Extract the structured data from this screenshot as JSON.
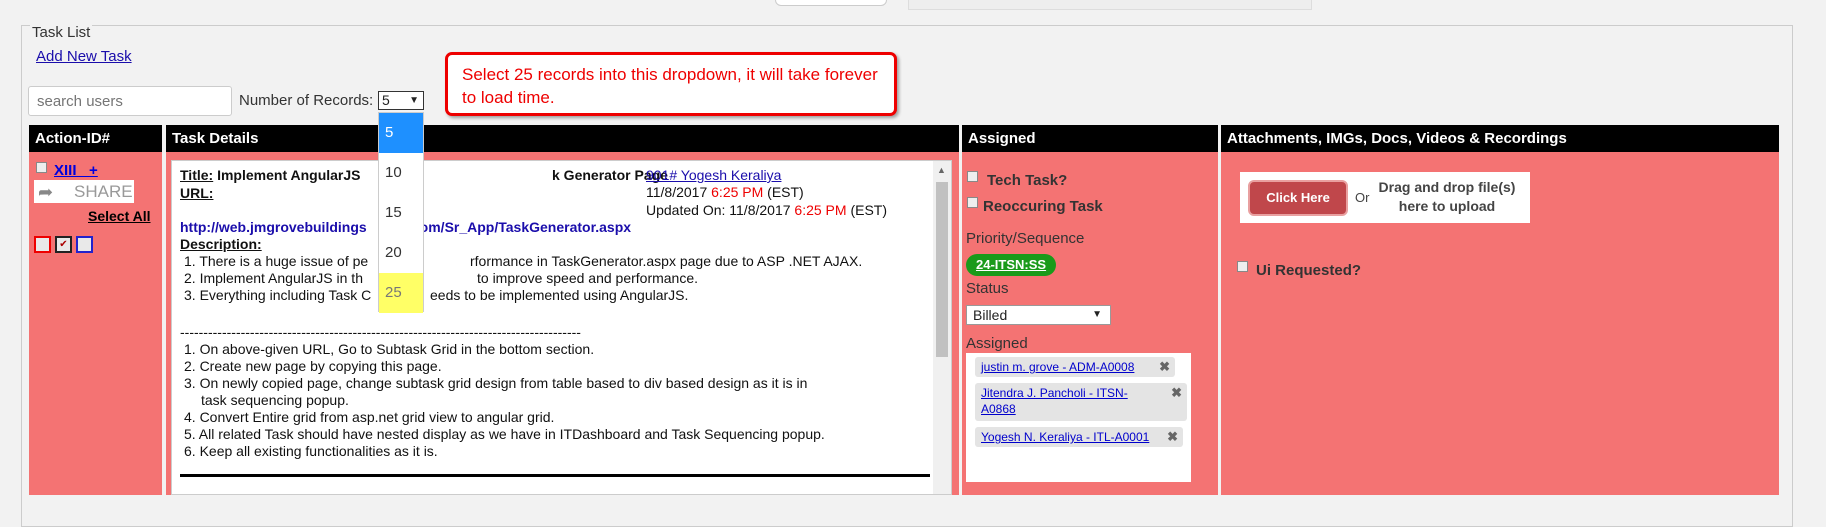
{
  "fieldset": {
    "legend": "Task List",
    "add_new_task": "Add New Task"
  },
  "search": {
    "placeholder": "search users"
  },
  "records": {
    "label": "Number of Records:",
    "selected": "5",
    "options": [
      "5",
      "10",
      "15",
      "20",
      "25"
    ]
  },
  "callout": {
    "text": "Select 25 records into this dropdown, it will take forever to load time."
  },
  "table": {
    "headers": [
      "Action-ID#",
      "Task Details",
      "Assigned",
      "Attachments, IMGs, Docs, Videos & Recordings"
    ]
  },
  "action": {
    "id_link": "XIII",
    "plus": "+",
    "share": "SHARE",
    "select_all": "Select All",
    "mini_check": "✔"
  },
  "task": {
    "title_label": "Title:",
    "title": "Implement AngularJS",
    "title_tail": "k Generator Page",
    "url_label": "URL:",
    "url_a": "http://web.jmgrovebuildings",
    "url_b": ".com/Sr_App/TaskGenerator.aspx",
    "owner_link": "901# Yogesh Keraliya",
    "created_date": "11/8/2017",
    "created_time": "6:25 PM",
    "tz": "(EST)",
    "updated_label": "Updated On: 11/8/2017",
    "updated_time": "6:25 PM",
    "description_label": "Description:",
    "desc_lines": [
      "1. There is a huge issue of pe",
      "1. There is a huge issue of performance in TaskGenerator.aspx page due to ASP .NET AJAX.",
      "2. Implement AngularJS in th",
      "to improve speed and performance.",
      "3. Everything including Task C",
      "eeds to be implemented using AngularJS."
    ],
    "separator": "--------------------------------------------------------------------------------------",
    "steps": [
      "1. On above-given URL, Go to Subtask Grid in the bottom section.",
      "2. Create new page by copying this page.",
      "3. On newly copied page, change subtask grid design from table based to div based design as it is in",
      "task sequencing popup.",
      "4. Convert Entire grid from asp.net grid view to angular grid.",
      "5. All related Task should have nested display as we have in ITDashboard and Task Sequencing popup.",
      "6. Keep all existing functionalities as it is."
    ]
  },
  "assigned": {
    "tech_task": "Tech Task?",
    "reoccurring": "Reoccuring Task",
    "priority_label": "Priority/Sequence",
    "priority_badge": "24-ITSN:SS",
    "status_label": "Status",
    "status_value": "Billed",
    "assigned_label": "Assigned",
    "assignees": [
      "justin m. grove - ADM-A0008",
      "Jitendra J. Pancholi - ITSN-A0868",
      "Yogesh N. Keraliya - ITL-A0001"
    ],
    "remove_icon": "✖"
  },
  "attachments": {
    "click_here": "Click Here",
    "or": "Or",
    "drag_drop": "Drag and drop file(s) here to upload",
    "ui_requested": "Ui Requested?"
  }
}
